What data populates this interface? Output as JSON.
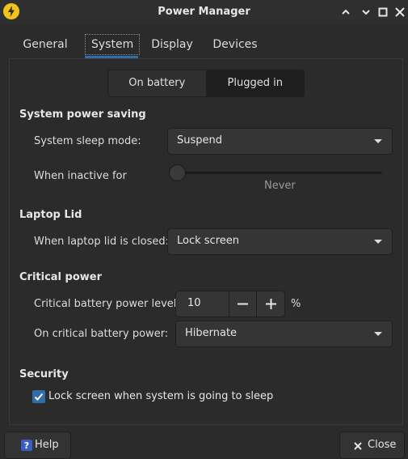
{
  "window": {
    "title": "Power Manager",
    "app_icon": "lightning-icon",
    "controls": [
      "minimize-icon",
      "maximize-icon",
      "close-icon"
    ]
  },
  "tabs": [
    {
      "label": "General",
      "active": false
    },
    {
      "label": "System",
      "active": true
    },
    {
      "label": "Display",
      "active": false
    },
    {
      "label": "Devices",
      "active": false
    }
  ],
  "power_source": {
    "on_battery": "On battery",
    "plugged_in": "Plugged in",
    "selected": "Plugged in"
  },
  "system_power_saving": {
    "heading": "System power saving",
    "sleep_mode_label": "System sleep mode:",
    "sleep_mode_value": "Suspend",
    "inactive_label": "When inactive for",
    "inactive_value": "Never",
    "inactive_fraction": 0
  },
  "laptop_lid": {
    "heading": "Laptop Lid",
    "lid_label": "When laptop lid is closed:",
    "lid_value": "Lock screen"
  },
  "critical_power": {
    "heading": "Critical power",
    "level_label": "Critical battery power level:",
    "level_value": "10",
    "level_unit": "%",
    "action_label": "On critical battery power:",
    "action_value": "Hibernate"
  },
  "security": {
    "heading": "Security",
    "lock_label": "Lock screen when system is going to sleep",
    "lock_checked": true
  },
  "footer": {
    "help_label": "Help",
    "close_label": "Close"
  },
  "colors": {
    "accent": "#2f6ea8",
    "window_bg": "#2b2b2b",
    "app_icon": "#f2c318"
  }
}
